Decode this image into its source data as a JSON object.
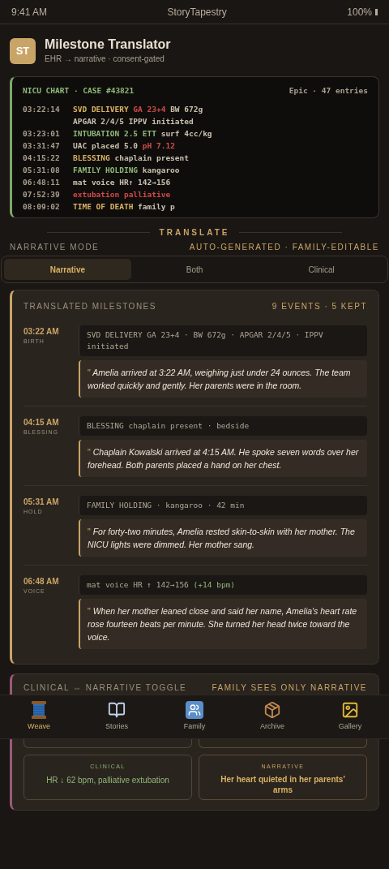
{
  "status_bar": {
    "time": "9:41 AM",
    "app": "StoryTapestry",
    "battery": "100%"
  },
  "header": {
    "logo": "ST",
    "title": "Milestone Translator",
    "subtitle": "EHR → narrative · consent-gated"
  },
  "chart": {
    "title": "NICU CHART · CASE #43821",
    "meta": "Epic · 47 entries",
    "lines": [
      {
        "time": "03:22:14",
        "segments": [
          {
            "text": "SVD DELIVERY",
            "color": "#d9b264"
          },
          {
            "text": "GA 23+4",
            "color": "#d04a4a"
          },
          {
            "text": "BW 672g"
          }
        ]
      },
      {
        "segments": [
          {
            "text": "APGAR 2/4/5"
          },
          {
            "text": "IPPV initiated"
          }
        ]
      },
      {
        "time": "03:23:01",
        "segments": [
          {
            "text": "INTUBATION 2.5 ETT",
            "color": "#8fb87a"
          },
          {
            "text": "surf 4cc/kg"
          }
        ]
      },
      {
        "time": "03:31:47",
        "segments": [
          {
            "text": "UAC placed"
          },
          {
            "text": "5.0"
          },
          {
            "text": "pH 7.12",
            "color": "#d04a4a"
          }
        ]
      },
      {
        "time": "04:15:22",
        "segments": [
          {
            "text": "BLESSING",
            "color": "#d9b264"
          },
          {
            "text": "chaplain present"
          }
        ]
      },
      {
        "time": "05:31:08",
        "segments": [
          {
            "text": "FAMILY HOLDING",
            "color": "#8fb87a"
          },
          {
            "text": "kangaroo"
          }
        ]
      },
      {
        "time": "06:48:11",
        "segments": [
          {
            "text": "mat voice"
          },
          {
            "text": "HR↑ 142→156"
          }
        ]
      },
      {
        "time": "07:52:39",
        "segments": [
          {
            "text": "extubation palliative",
            "color": "#d04a4a"
          }
        ]
      },
      {
        "time": "08:09:02",
        "segments": [
          {
            "text": "TIME OF DEATH",
            "color": "#d9b264"
          },
          {
            "text": "family p"
          }
        ]
      }
    ]
  },
  "translate_label": "TRANSLATE",
  "mode": {
    "label": "NARRATIVE MODE",
    "note": "AUTO-GENERATED · FAMILY-EDITABLE"
  },
  "tabs": [
    {
      "label": "Narrative",
      "selected": true
    },
    {
      "label": "Both",
      "selected": false
    },
    {
      "label": "Clinical",
      "selected": false
    }
  ],
  "milestones": {
    "title": "TRANSLATED MILESTONES",
    "count": "9 EVENTS · 5 KEPT",
    "items": [
      {
        "time": "03:22 AM",
        "tag": "BIRTH",
        "clinical": [
          {
            "text": "SVD DELIVERY GA 23+4 · BW 672g · APGAR 2/4/5 · IPPV initiated"
          }
        ],
        "quote_mark": "\"",
        "narrative": "Amelia arrived at 3:22 AM, weighing just under 24 ounces. The team worked quickly and gently. Her parents were in the room."
      },
      {
        "time": "04:15 AM",
        "tag": "BLESSING",
        "clinical": [
          {
            "text": "BLESSING chaplain present · bedside"
          }
        ],
        "quote_mark": "\"",
        "narrative": "Chaplain Kowalski arrived at 4:15 AM. He spoke seven words over her forehead. Both parents placed a hand on her chest."
      },
      {
        "time": "05:31 AM",
        "tag": "HOLD",
        "clinical": [
          {
            "text": "FAMILY HOLDING · kangaroo · 42 min"
          }
        ],
        "quote_mark": "\"",
        "narrative": "For forty-two minutes, Amelia rested skin-to-skin with her mother. The NICU lights were dimmed. Her mother sang."
      },
      {
        "time": "06:48 AM",
        "tag": "VOICE",
        "clinical": [
          {
            "text": "mat voice HR ↑ 142→156"
          },
          {
            "text": "(+14 bpm)",
            "color": "#8fb87a"
          }
        ],
        "quote_mark": "\"",
        "narrative": "When her mother leaned close and said her name, Amelia's heart rate rose fourteen beats per minute. She turned her head twice toward the voice."
      }
    ]
  },
  "toggle": {
    "title": "CLINICAL ⇔ NARRATIVE TOGGLE",
    "note": "FAMILY SEES ONLY NARRATIVE",
    "pairs": [
      {
        "clinical_label": "CLINICAL",
        "clinical": "HR ↓ 62 bpm, palliative extubation",
        "narrative_label": "NARRATIVE",
        "narrative": "Her heart quieted in her parents' arms"
      }
    ]
  },
  "nav": [
    {
      "label": "Weave",
      "selected": true
    },
    {
      "label": "Stories",
      "selected": false
    },
    {
      "label": "Family",
      "selected": false
    },
    {
      "label": "Archive",
      "selected": false
    },
    {
      "label": "Gallery",
      "selected": false
    }
  ]
}
